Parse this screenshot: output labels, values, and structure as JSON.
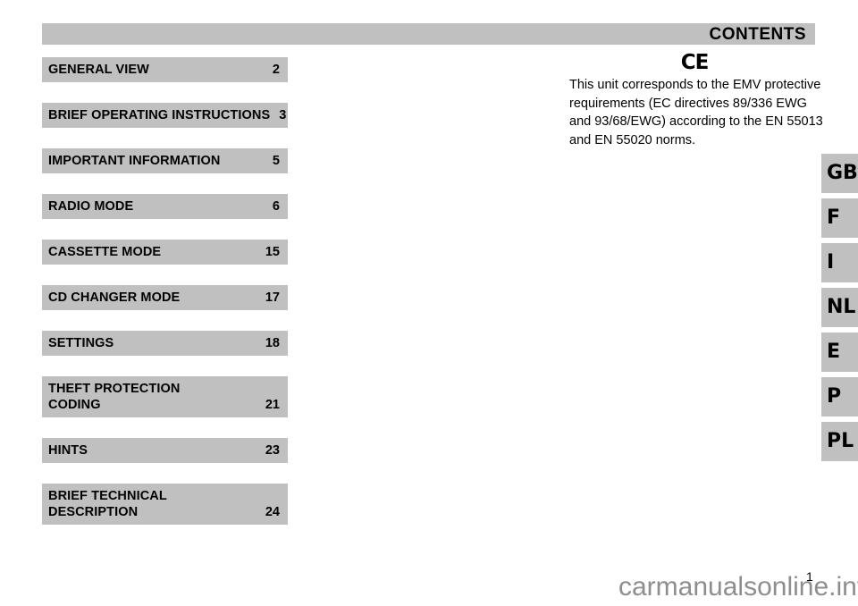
{
  "header": {
    "title": "CONTENTS"
  },
  "contents": {
    "items": [
      {
        "label": "GENERAL VIEW",
        "label2": "",
        "page": "2"
      },
      {
        "label": "BRIEF OPERATING INSTRUCTIONS",
        "label2": "",
        "page": "3"
      },
      {
        "label": "IMPORTANT INFORMATION",
        "label2": "",
        "page": "5"
      },
      {
        "label": "RADIO MODE",
        "label2": "",
        "page": "6"
      },
      {
        "label": "CASSETTE MODE",
        "label2": "",
        "page": "15"
      },
      {
        "label": "CD CHANGER MODE",
        "label2": "",
        "page": "17"
      },
      {
        "label": "SETTINGS",
        "label2": "",
        "page": "18"
      },
      {
        "label": "THEFT PROTECTION",
        "label2": "CODING",
        "page": "21"
      },
      {
        "label": "HINTS",
        "label2": "",
        "page": "23"
      },
      {
        "label": "BRIEF TECHNICAL",
        "label2": "DESCRIPTION",
        "page": "24"
      }
    ]
  },
  "ce_notice": {
    "mark": "CE",
    "text": "This unit corresponds to the EMV protective requirements (EC directives 89/336 EWG and 93/68/EWG) according to the EN 55013 and EN 55020 norms."
  },
  "language_tabs": [
    {
      "code": "GB"
    },
    {
      "code": "F"
    },
    {
      "code": "I"
    },
    {
      "code": "NL"
    },
    {
      "code": "E"
    },
    {
      "code": "P"
    },
    {
      "code": "PL"
    }
  ],
  "footer": {
    "page_number": "1",
    "watermark": "carmanualsonline.info"
  },
  "colors": {
    "panel_gray": "#c0c0c0",
    "text": "#000000",
    "watermark_gray": "#8e8e8e",
    "background": "#ffffff"
  }
}
